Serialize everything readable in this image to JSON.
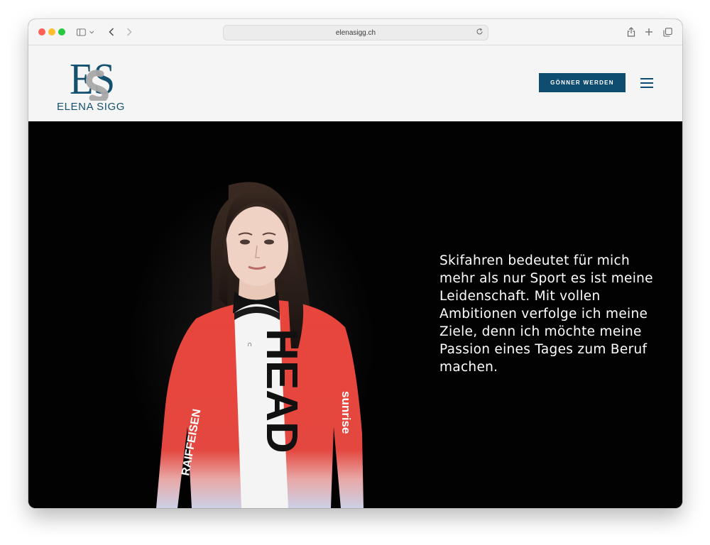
{
  "browser": {
    "url": "elenasigg.ch",
    "buttons": [
      "sidebar-toggle",
      "back",
      "forward",
      "share",
      "new-tab",
      "tab-overview"
    ]
  },
  "site": {
    "logo_monogram": "ES",
    "logo_name": "ELENA SIGG",
    "cta_label": "GÖNNER WERDEN",
    "menu_icon": "hamburger-icon"
  },
  "hero": {
    "quote": "Skifahren bedeutet für mich mehr als nur Sport es ist meine Leidenschaft. Mit vollen Ambitionen verfolge ich meine Ziele, denn ich möchte meine Passion eines Tages zum Beruf machen.",
    "ski_brand": "HEAD",
    "sponsor_left": "RAIFFEISEN",
    "sponsor_right": "sunrise"
  },
  "colors": {
    "brand_blue": "#0f4d70",
    "header_bg": "#f5f5f5",
    "hero_bg": "#020202",
    "suit_red": "#e8453c"
  }
}
